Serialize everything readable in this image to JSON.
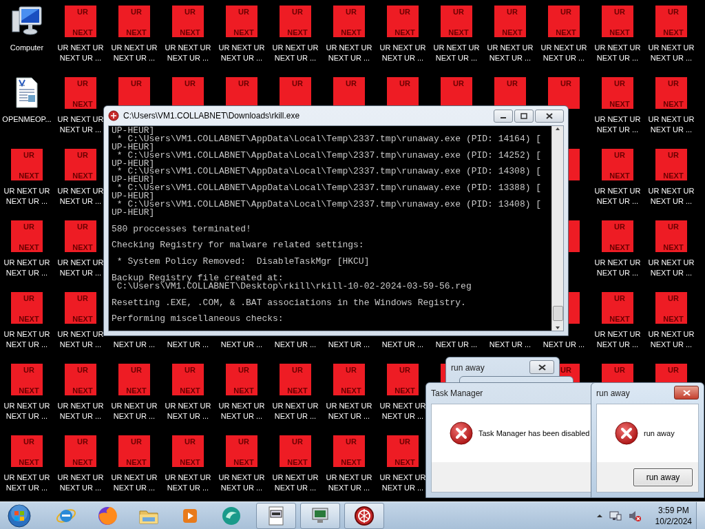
{
  "desktop": {
    "rows": [
      [
        {
          "kind": "computer",
          "label": "Computer"
        },
        {
          "kind": "tile",
          "top": "UR",
          "bottom": "NEXT",
          "label": "UR NEXT UR NEXT UR ..."
        },
        {
          "kind": "tile",
          "top": "UR",
          "bottom": "NEXT",
          "label": "UR NEXT UR NEXT UR ..."
        },
        {
          "kind": "tile",
          "top": "UR",
          "bottom": "NEXT",
          "label": "UR NEXT UR NEXT UR ..."
        },
        {
          "kind": "tile",
          "top": "UR",
          "bottom": "NEXT",
          "label": "UR NEXT UR NEXT UR ..."
        },
        {
          "kind": "tile",
          "top": "UR",
          "bottom": "NEXT",
          "label": "UR NEXT UR NEXT UR ..."
        },
        {
          "kind": "tile",
          "top": "UR",
          "bottom": "NEXT",
          "label": "UR NEXT UR NEXT UR ..."
        },
        {
          "kind": "tile",
          "top": "UR",
          "bottom": "NEXT",
          "label": "UR NEXT UR NEXT UR ..."
        },
        {
          "kind": "tile",
          "top": "UR",
          "bottom": "NEXT",
          "label": "UR NEXT UR NEXT UR ..."
        },
        {
          "kind": "tile",
          "top": "UR",
          "bottom": "NEXT",
          "label": "UR NEXT UR NEXT UR ..."
        },
        {
          "kind": "tile",
          "top": "UR",
          "bottom": "NEXT",
          "label": "UR NEXT UR NEXT UR ..."
        },
        {
          "kind": "tile",
          "top": "UR",
          "bottom": "NEXT",
          "label": "UR NEXT UR NEXT UR ..."
        },
        {
          "kind": "tile",
          "top": "UR",
          "bottom": "NEXT",
          "label": "UR NEXT UR NEXT UR ..."
        }
      ],
      [
        {
          "kind": "document",
          "label": "OPENMEOP..."
        },
        {
          "kind": "tile",
          "top": "UR",
          "bottom": "NEXT",
          "label": "UR NEXT UR NEXT UR ..."
        },
        {
          "kind": "tile",
          "top": "UR"
        },
        {
          "kind": "tile",
          "top": "UR"
        },
        {
          "kind": "tile",
          "top": "UR"
        },
        {
          "kind": "tile",
          "top": "UR"
        },
        {
          "kind": "tile",
          "top": "UR"
        },
        {
          "kind": "tile",
          "top": "UR"
        },
        {
          "kind": "tile",
          "top": "UR"
        },
        {
          "kind": "tile",
          "top": "UR"
        },
        {
          "kind": "tile",
          "top": "UR"
        },
        {
          "kind": "tile",
          "top": "UR",
          "bottom": "NEXT",
          "label": "UR NEXT UR NEXT UR ..."
        },
        {
          "kind": "tile",
          "top": "UR",
          "bottom": "NEXT",
          "label": "UR NEXT UR NEXT UR ..."
        }
      ],
      [
        {
          "kind": "tile",
          "top": "UR",
          "bottom": "NEXT",
          "label": "UR NEXT UR NEXT UR ..."
        },
        {
          "kind": "tile",
          "top": "UR",
          "bottom": "NEXT",
          "label": "UR NEXT UR NEXT UR ..."
        },
        null,
        null,
        null,
        null,
        null,
        null,
        null,
        null,
        {
          "kind": "tile"
        },
        {
          "kind": "tile",
          "top": "UR",
          "bottom": "NEXT",
          "label": "UR NEXT UR NEXT UR ..."
        },
        {
          "kind": "tile",
          "top": "UR",
          "bottom": "NEXT",
          "label": "UR NEXT UR NEXT UR ..."
        }
      ],
      [
        {
          "kind": "tile",
          "top": "UR",
          "bottom": "NEXT",
          "label": "UR NEXT UR NEXT UR ..."
        },
        {
          "kind": "tile",
          "top": "UR",
          "bottom": "NEXT",
          "label": "UR NEXT UR NEXT UR ..."
        },
        null,
        null,
        null,
        null,
        null,
        null,
        null,
        null,
        {
          "kind": "tile"
        },
        {
          "kind": "tile",
          "top": "UR",
          "bottom": "NEXT",
          "label": "UR NEXT UR NEXT UR ..."
        },
        {
          "kind": "tile",
          "top": "UR",
          "bottom": "NEXT",
          "label": "UR NEXT UR NEXT UR ..."
        }
      ],
      [
        {
          "kind": "tile",
          "top": "UR",
          "bottom": "NEXT",
          "label": "UR NEXT UR NEXT UR ..."
        },
        {
          "kind": "tile",
          "top": "UR",
          "bottom": "NEXT",
          "label": "UR NEXT UR NEXT UR ..."
        },
        {
          "kind": "hidden_tile",
          "label": "NEXT UR ..."
        },
        {
          "kind": "hidden_tile",
          "label": "NEXT UR ..."
        },
        {
          "kind": "hidden_tile",
          "label": "NEXT UR ..."
        },
        {
          "kind": "hidden_tile",
          "label": "NEXT UR ..."
        },
        {
          "kind": "hidden_tile",
          "label": "NEXT UR ..."
        },
        {
          "kind": "hidden_tile",
          "label": "NEXT UR ..."
        },
        {
          "kind": "hidden_tile",
          "label": "NEXT UR ..."
        },
        {
          "kind": "hidden_tile",
          "label": "NEXT UR ..."
        },
        {
          "kind": "tile_tail",
          "label": "NEXT UR ..."
        },
        {
          "kind": "tile",
          "top": "UR",
          "bottom": "NEXT",
          "label": "UR NEXT UR NEXT UR ..."
        },
        {
          "kind": "tile",
          "top": "UR",
          "bottom": "NEXT",
          "label": "UR NEXT UR NEXT UR ..."
        }
      ],
      [
        {
          "kind": "tile",
          "top": "UR",
          "bottom": "NEXT",
          "label": "UR NEXT UR NEXT UR ..."
        },
        {
          "kind": "tile",
          "top": "UR",
          "bottom": "NEXT",
          "label": "UR NEXT UR NEXT UR ..."
        },
        {
          "kind": "tile",
          "top": "UR",
          "bottom": "NEXT",
          "label": "UR NEXT UR NEXT UR ..."
        },
        {
          "kind": "tile",
          "top": "UR",
          "bottom": "NEXT",
          "label": "UR NEXT UR NEXT UR ..."
        },
        {
          "kind": "tile",
          "top": "UR",
          "bottom": "NEXT",
          "label": "UR NEXT UR NEXT UR ..."
        },
        {
          "kind": "tile",
          "top": "UR",
          "bottom": "NEXT",
          "label": "UR NEXT UR NEXT UR ..."
        },
        {
          "kind": "tile",
          "top": "UR",
          "bottom": "NEXT",
          "label": "UR NEXT UR NEXT UR ..."
        },
        {
          "kind": "tile",
          "top": "UR",
          "bottom": "NEXT",
          "label": "UR NEXT UR NEXT UR ..."
        },
        {
          "kind": "tile"
        },
        null,
        {
          "kind": "tile",
          "top": "UR"
        },
        {
          "kind": "tile",
          "top": "UR"
        },
        {
          "kind": "tile",
          "top": "UR"
        }
      ],
      [
        {
          "kind": "tile",
          "top": "UR",
          "bottom": "NEXT",
          "label": "UR NEXT UR NEXT UR ..."
        },
        {
          "kind": "tile",
          "top": "UR",
          "bottom": "NEXT",
          "label": "UR NEXT UR NEXT UR ..."
        },
        {
          "kind": "tile",
          "top": "UR",
          "bottom": "NEXT",
          "label": "UR NEXT UR NEXT UR ..."
        },
        {
          "kind": "tile",
          "top": "UR",
          "bottom": "NEXT",
          "label": "UR NEXT UR NEXT UR ..."
        },
        {
          "kind": "tile",
          "top": "UR",
          "bottom": "NEXT",
          "label": "UR NEXT UR NEXT UR ..."
        },
        {
          "kind": "tile",
          "top": "UR",
          "bottom": "NEXT",
          "label": "UR NEXT UR NEXT UR ..."
        },
        {
          "kind": "tile",
          "top": "UR",
          "bottom": "NEXT",
          "label": "UR NEXT UR NEXT UR ..."
        },
        {
          "kind": "tile",
          "top": "UR",
          "bottom": "NEXT",
          "label": "UR NEXT UR NEXT UR ..."
        }
      ]
    ]
  },
  "console": {
    "title": "C:\\Users\\VM1.COLLABNET\\Downloads\\rkill.exe",
    "blocks": [
      [
        "UP-HEUR]",
        " * C:\\Users\\VM1.COLLABNET\\AppData\\Local\\Temp\\2337.tmp\\runaway.exe (PID: 14164) [",
        "UP-HEUR]",
        " * C:\\Users\\VM1.COLLABNET\\AppData\\Local\\Temp\\2337.tmp\\runaway.exe (PID: 14252) [",
        "UP-HEUR]",
        " * C:\\Users\\VM1.COLLABNET\\AppData\\Local\\Temp\\2337.tmp\\runaway.exe (PID: 14308) [",
        "UP-HEUR]",
        " * C:\\Users\\VM1.COLLABNET\\AppData\\Local\\Temp\\2337.tmp\\runaway.exe (PID: 13388) [",
        "UP-HEUR]",
        " * C:\\Users\\VM1.COLLABNET\\AppData\\Local\\Temp\\2337.tmp\\runaway.exe (PID: 13408) [",
        "UP-HEUR]"
      ],
      [
        "580 proccesses terminated!"
      ],
      [
        "Checking Registry for malware related settings:"
      ],
      [
        " * System Policy Removed:  DisableTaskMgr [HKCU]"
      ],
      [
        "Backup Registry file created at:",
        " C:\\Users\\VM1.COLLABNET\\Desktop\\rkill\\rkill-10-02-2024-03-59-56.reg"
      ],
      [
        "Resetting .EXE, .COM, & .BAT associations in the Windows Registry."
      ],
      [
        "Performing miscellaneous checks:"
      ]
    ]
  },
  "dialogs": [
    {
      "kind": "dialog",
      "title": "run away",
      "active": false,
      "close_button": true
    },
    {
      "kind": "dialog",
      "close_button": false
    },
    {
      "kind": "dialog",
      "title": "Task Manager",
      "message": "Task Manager has been disabled",
      "active": false,
      "close_button": false
    },
    {
      "kind": "dialog",
      "title": "run away",
      "message": "run away",
      "button": "run away",
      "active": true,
      "close_button": true
    }
  ],
  "taskbar": {
    "items": [
      {
        "kind": "start"
      },
      {
        "kind": "globe",
        "running": false
      },
      {
        "kind": "fox",
        "running": false
      },
      {
        "kind": "folder",
        "running": false
      },
      {
        "kind": "play",
        "running": false
      },
      {
        "kind": "swirl",
        "running": false
      },
      {
        "kind": "page",
        "running": true
      },
      {
        "kind": "monitor",
        "running": true
      },
      {
        "kind": "emblem",
        "running": true
      }
    ],
    "tray": {
      "time": "3:59 PM",
      "date": "10/2/2024"
    }
  }
}
